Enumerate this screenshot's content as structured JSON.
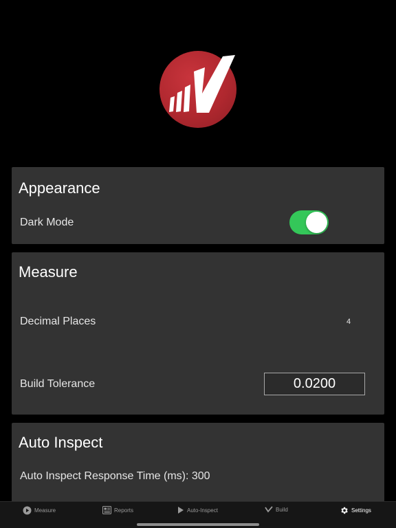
{
  "appearance": {
    "title": "Appearance",
    "dark_mode_label": "Dark Mode",
    "dark_mode_on": true
  },
  "measure": {
    "title": "Measure",
    "decimal_places_label": "Decimal Places",
    "decimal_places_value": "4",
    "build_tolerance_label": "Build Tolerance",
    "build_tolerance_value": "0.0200"
  },
  "auto_inspect": {
    "title": "Auto Inspect",
    "response_time_text": "Auto Inspect Response Time (ms): 300"
  },
  "tabs": [
    {
      "label": "Measure",
      "icon": "play-circle-icon",
      "active": false
    },
    {
      "label": "Reports",
      "icon": "newspaper-icon",
      "active": false
    },
    {
      "label": "Auto-Inspect",
      "icon": "play-triangle-icon",
      "active": false
    },
    {
      "label": "Build",
      "icon": "checkmark-icon",
      "active": false
    },
    {
      "label": "Settings",
      "icon": "gear-icon",
      "active": true
    }
  ],
  "colors": {
    "logo_red": "#b0282f",
    "toggle_on": "#34c759",
    "card_bg": "#333333"
  }
}
